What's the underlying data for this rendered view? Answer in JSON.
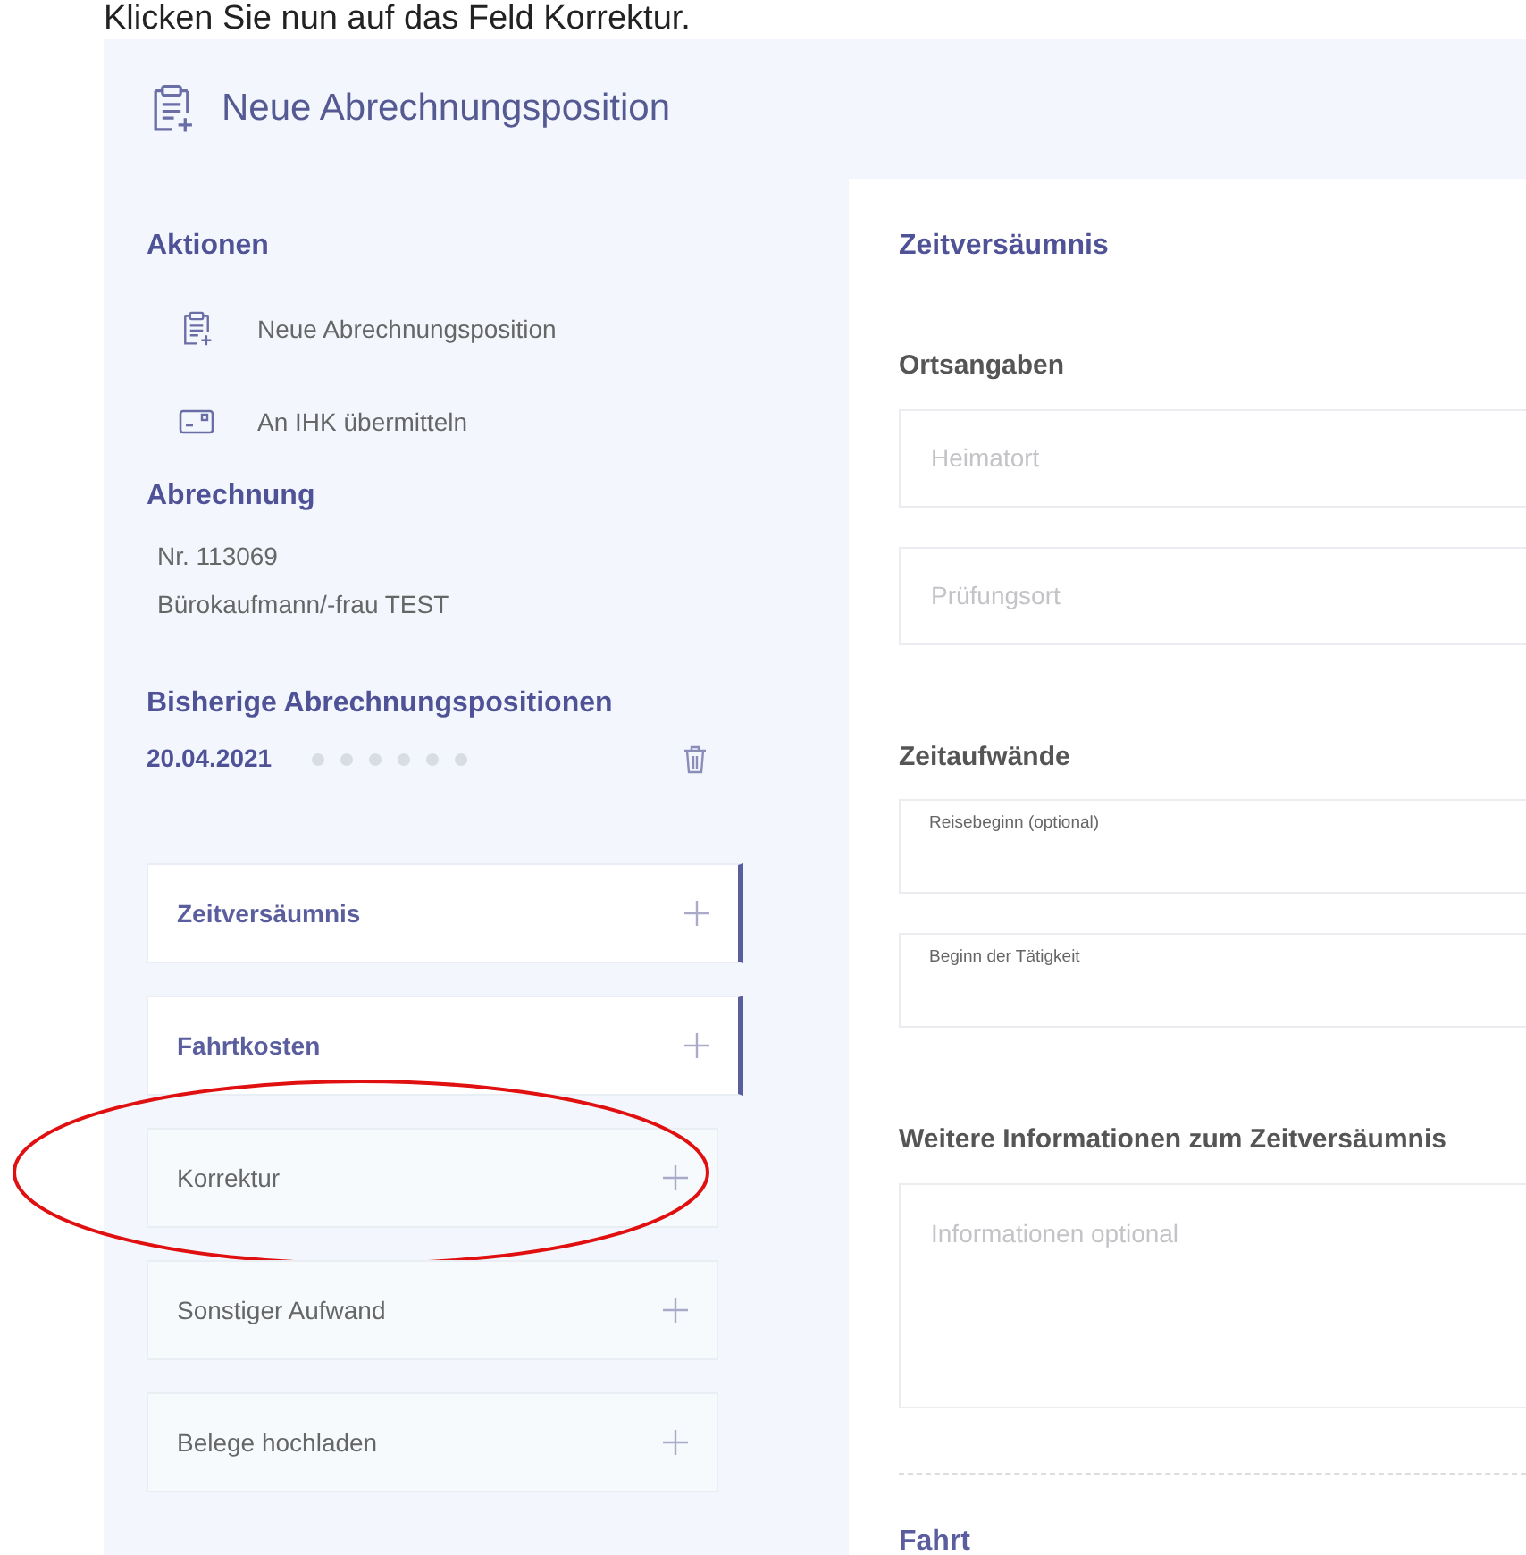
{
  "caption": "Klicken Sie nun auf das Feld Korrektur.",
  "header": {
    "title": "Neue Abrechnungsposition"
  },
  "sidebar": {
    "actions": {
      "heading": "Aktionen",
      "items": [
        {
          "kind": "new",
          "label": "Neue Abrechnungsposition"
        },
        {
          "kind": "send",
          "label": "An IHK übermitteln"
        }
      ]
    },
    "billing": {
      "heading": "Abrechnung",
      "lines": [
        "Nr. 113069",
        "Bürokaufmann/-frau TEST"
      ]
    },
    "previous": {
      "heading": "Bisherige Abrechnungspositionen",
      "entries": [
        {
          "date": "20.04.2021"
        }
      ]
    },
    "sections": [
      {
        "label": "Zeitversäumnis",
        "active": true,
        "highlighted": false
      },
      {
        "label": "Fahrtkosten",
        "active": true,
        "highlighted": false
      },
      {
        "label": "Korrektur",
        "active": false,
        "highlighted": true
      },
      {
        "label": "Sonstiger Aufwand",
        "active": false,
        "highlighted": false
      },
      {
        "label": "Belege hochladen",
        "active": false,
        "highlighted": false
      }
    ]
  },
  "form": {
    "title": "Zeitversäumnis",
    "groups": [
      {
        "heading": "Ortsangaben",
        "fields": [
          {
            "kind": "input",
            "placeholder": "Heimatort"
          },
          {
            "kind": "input",
            "placeholder": "Prüfungsort"
          }
        ]
      },
      {
        "heading": "Zeitaufwände",
        "fields": [
          {
            "kind": "labeled",
            "label": "Reisebeginn (optional)"
          },
          {
            "kind": "labeled",
            "label": "Beginn der Tätigkeit"
          }
        ]
      },
      {
        "heading": "Weitere Informationen zum Zeitversäumnis",
        "fields": [
          {
            "kind": "textarea",
            "placeholder": "Informationen optional"
          }
        ]
      }
    ],
    "next_section": "Fahrt"
  }
}
